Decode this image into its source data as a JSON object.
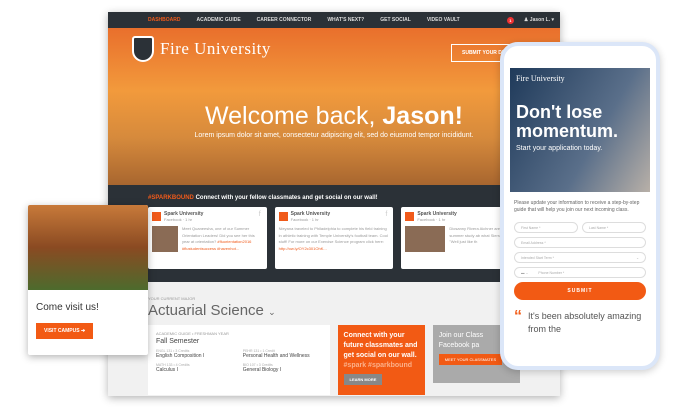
{
  "nav": {
    "items": [
      "DASHBOARD",
      "ACADEMIC GUIDE",
      "CAREER CONNECTOR",
      "WHAT'S NEXT?",
      "GET SOCIAL",
      "VIDEO VAULT"
    ],
    "notifications": "1",
    "user": "Jason L."
  },
  "hero": {
    "logo": "Fire University",
    "submit": "SUBMIT YOUR DE",
    "welcome": "Welcome back, ",
    "name": "Jason!",
    "lorem": "Lorem ipsum dolor sit amet, consectetur adipiscing elit, sed do eiusmod tempor incididunt."
  },
  "social": {
    "hashtag": "#SPARKBOUND",
    "heading": " Connect with your fellow classmates and get social on our wall!",
    "posts": [
      {
        "name": "Spark University",
        "meta": "Facebook · 1 hr",
        "text": "Meet Quaneesha, one of our Summer Orientation Leaders! Did you see her this year at orientation? ",
        "tags": "#fluorientation2016 #flustudentsuccess #havenhot..."
      },
      {
        "name": "Spark University",
        "meta": "Facebook · 1 hr",
        "text": "Nieyana traveled to Philadelphia to complete his field training in athletic training with Temple University's football team. Cool stuff! For more on our Exercise Science program click here: ",
        "tags": "http://ow.ly/OY2c301OhK..."
      },
      {
        "name": "Spark University",
        "meta": "Facebook · 1 hr",
        "text": "Diosanny Rivera Aichner are wrap summer study ab what Sierra has t \"Well just like th",
        "tags": ""
      }
    ]
  },
  "lower": {
    "label": "YOUR CURRENT MAJOR",
    "major": "Actuarial Science",
    "guide_label": "ACADEMIC GUIDE • FRESHMAN YEAR",
    "semester": "Fall Semester",
    "courses": [
      {
        "code": "ENGL 131 • 3 Credits",
        "name": "English Composition I"
      },
      {
        "code": "PEHR 131 • 1 Credit",
        "name": "Personal Health and Wellness"
      },
      {
        "code": "MATH 133 • 4 Credits",
        "name": "Calculus I"
      },
      {
        "code": "BIO 107 • 3 Credits",
        "name": "General Biology I"
      }
    ],
    "connect": "Connect with your future classmates and get social on our wall.",
    "connect_tags": "#spark #sparkbound",
    "learn_more": "LEARN MORE",
    "join": "Join our Class Facebook pa",
    "meet": "MEET YOUR CLASSMATES"
  },
  "visit": {
    "title": "Come visit us!",
    "button": "VISIT CAMPUS"
  },
  "phone": {
    "logo": "Fire University",
    "headline": "Don't lose momentum.",
    "sub": "Start your application today.",
    "intro": "Please update your information to receive a step-by-step guide that will help you join our next incoming class.",
    "first": "First Name *",
    "last": "Last Name *",
    "email": "Email Address *",
    "term": "Intended Start Term *",
    "phone": "Phone Number *",
    "submit": "SUBMIT",
    "quote": "It's been absolutely amazing from the"
  }
}
